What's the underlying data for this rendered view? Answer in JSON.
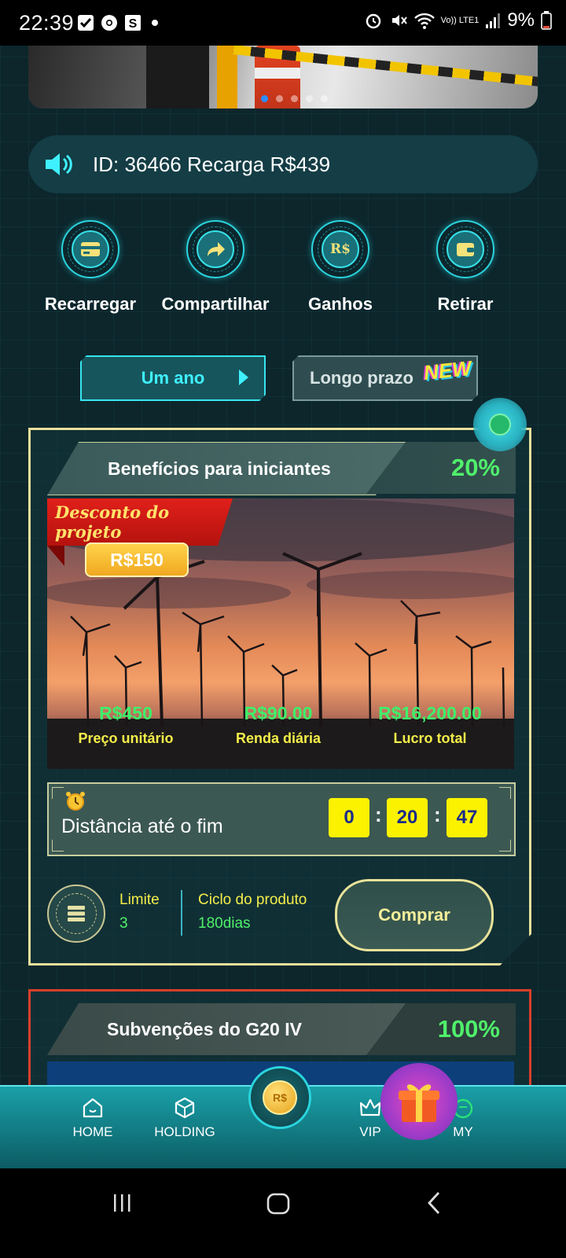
{
  "status_bar": {
    "time": "22:39",
    "battery": "9%",
    "network": "Vo)) LTE1"
  },
  "notice": {
    "text": "ID: 36466 Recarga R$439"
  },
  "quick_actions": [
    {
      "label": "Recarregar",
      "icon": "card-icon"
    },
    {
      "label": "Compartilhar",
      "icon": "share-icon"
    },
    {
      "label": "Ganhos",
      "icon": "currency-icon",
      "icon_text": "R$"
    },
    {
      "label": "Retirar",
      "icon": "wallet-icon"
    }
  ],
  "tabs": [
    {
      "label": "Um ano",
      "active": true
    },
    {
      "label": "Longo prazo",
      "active": false,
      "badge": "NEW"
    }
  ],
  "product_card": {
    "title": "Benefícios para iniciantes",
    "percent": "20%",
    "ribbon": "Desconto do projeto",
    "discount": "R$150",
    "stats": [
      {
        "value": "R$450",
        "label": "Preço unitário"
      },
      {
        "value": "R$90.00",
        "label": "Renda diária"
      },
      {
        "value": "R$16,200.00",
        "label": "Lucro total"
      }
    ],
    "countdown": {
      "label": "Distância até o fim",
      "hours": "0",
      "minutes": "20",
      "seconds": "47"
    },
    "limit_label": "Limite",
    "limit_value": "3",
    "cycle_label": "Ciclo do produto",
    "cycle_value": "180dias",
    "buy_label": "Comprar"
  },
  "product_card_2": {
    "title": "Subvenções do G20 IV",
    "percent": "100%"
  },
  "bottom_nav": [
    {
      "label": "HOME",
      "icon": "home-icon"
    },
    {
      "label": "HOLDING",
      "icon": "box-icon"
    },
    {
      "label": "",
      "icon": "coin-icon",
      "icon_text": "R$"
    },
    {
      "label": "VIP",
      "icon": "crown-icon"
    },
    {
      "label": "MY",
      "icon": "profile-icon"
    }
  ],
  "colors": {
    "background": "#0c262c",
    "accent_cyan": "#3ff1ff",
    "value_green": "#4ff06a",
    "label_yellow": "#f4ee4a",
    "card_border": "#e8e09a",
    "card2_border": "#d8402a"
  }
}
